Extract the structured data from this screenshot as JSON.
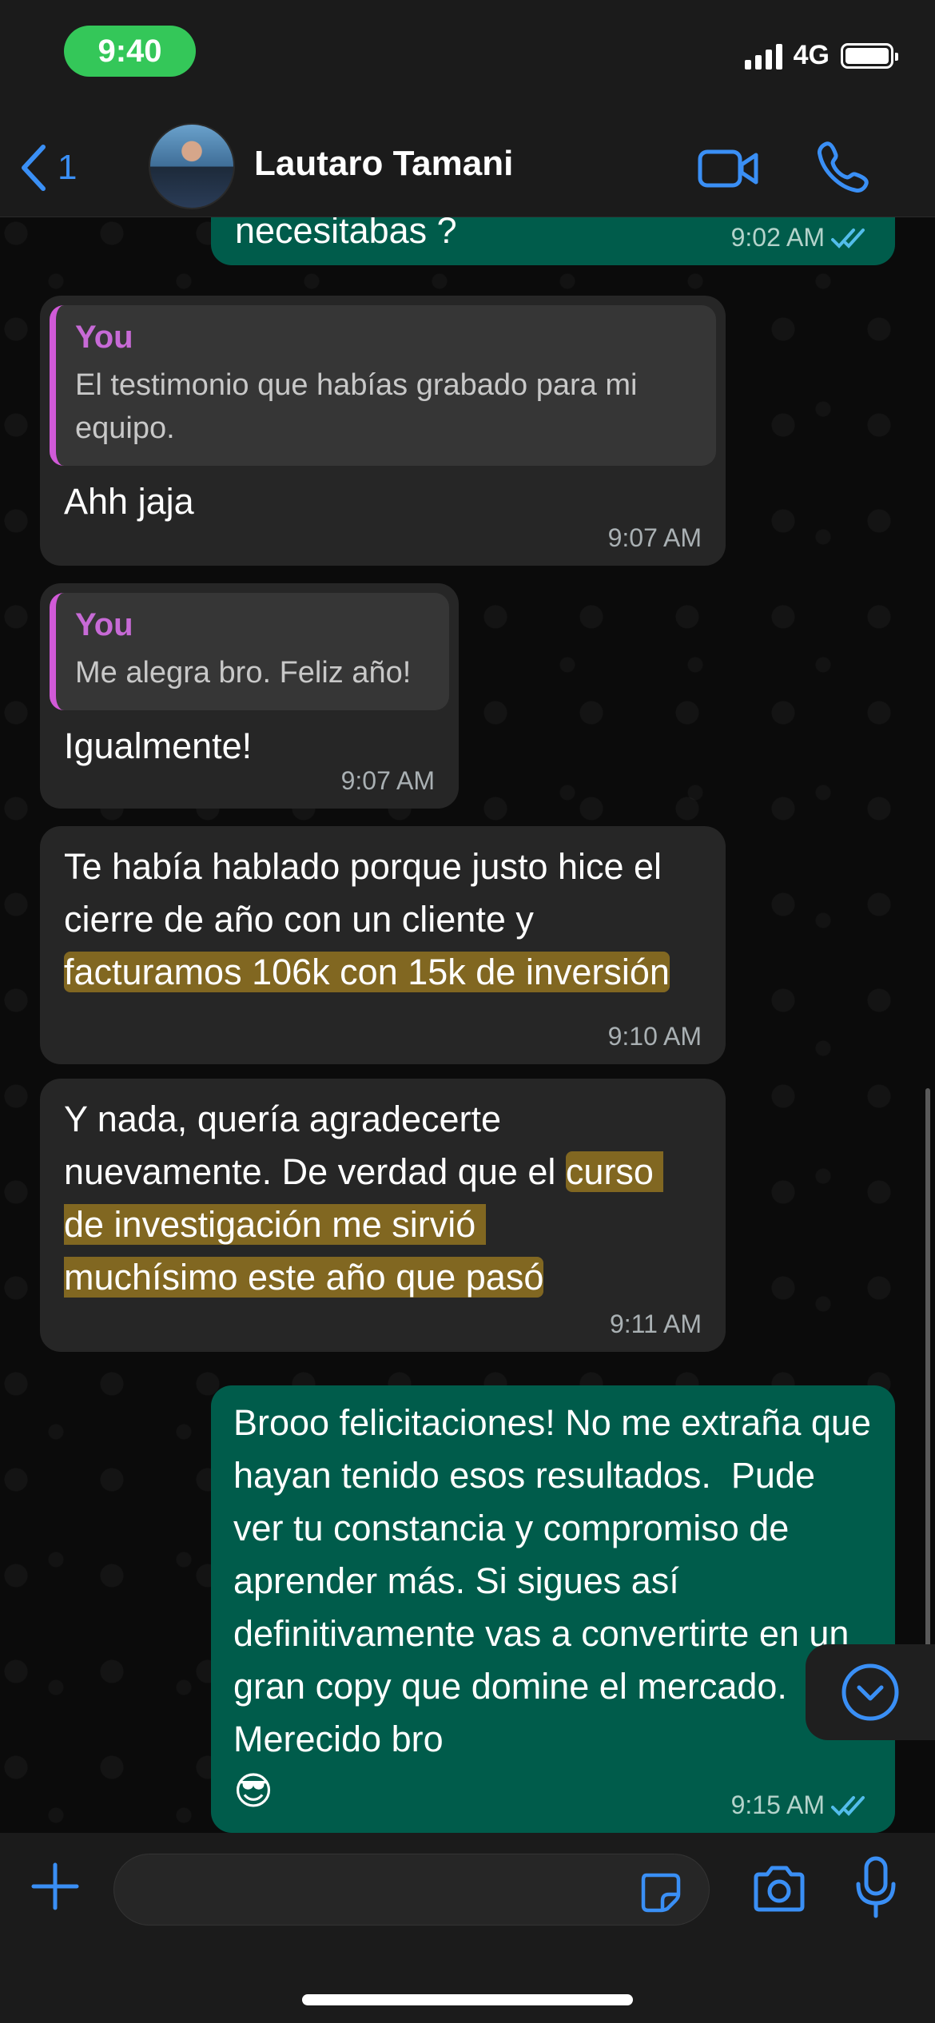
{
  "status": {
    "time": "9:40",
    "network": "4G"
  },
  "header": {
    "back_count": "1",
    "contact_name": "Lautaro Tamani",
    "icons": [
      "chevron-left-icon",
      "video-call-icon",
      "phone-icon"
    ]
  },
  "messages": [
    {
      "id": "m0",
      "direction": "outgoing",
      "text": "necesitabas ?",
      "time": "9:02 AM",
      "read": true
    },
    {
      "id": "m1",
      "direction": "incoming",
      "quote_author": "You",
      "quote_text": "El testimonio que habías grabado para mi equipo.",
      "text": "Ahh jaja",
      "time": "9:07 AM"
    },
    {
      "id": "m2",
      "direction": "incoming",
      "quote_author": "You",
      "quote_text": "Me alegra bro. Feliz año!",
      "text": "Igualmente!",
      "time": "9:07 AM"
    },
    {
      "id": "m3",
      "direction": "incoming",
      "text_parts": [
        "Te había hablado porque justo hice el cierre de año con un cliente y ",
        "facturamos 106k con 15k de inversión"
      ],
      "time": "9:10 AM"
    },
    {
      "id": "m4",
      "direction": "incoming",
      "text_parts": [
        "Y nada, quería agradecerte nuevamente. De verdad que el ",
        "curso de investigación me sirvió muchísimo este año que pasó"
      ],
      "time": "9:11 AM"
    },
    {
      "id": "m5",
      "direction": "outgoing",
      "text": "Brooo felicitaciones! No me extraña que hayan tenido esos resultados.  Pude ver tu constancia y compromiso de aprender más. Si sigues así definitivamente vas a convertirte en un gran copy que domine el mercado. Merecido bro",
      "emoji": "😎",
      "time": "9:15 AM",
      "read": true
    }
  ],
  "input": {
    "placeholder": "",
    "value": ""
  },
  "colors": {
    "incoming_bubble": "#262626",
    "outgoing_bubble": "#005c4b",
    "accent": "#3a8ff5",
    "quote_author": "#c76ad6",
    "highlight": "#a07e20"
  }
}
